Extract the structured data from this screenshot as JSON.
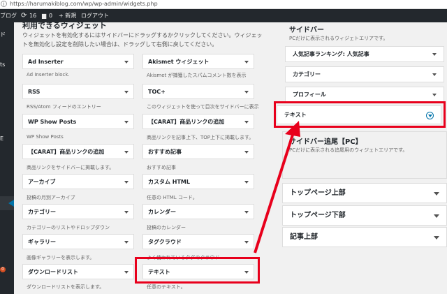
{
  "browser": {
    "url": "https://harumakiblog.com/wp/wp-admin/widgets.php",
    "info_icon": "info-icon"
  },
  "adminbar": {
    "site": "ブログ",
    "updates": "16",
    "comments": "0",
    "new": "+ 新規",
    "logout": "ログアウト"
  },
  "sidebar": {
    "items": [
      "ド",
      "ts",
      "E"
    ],
    "badge": "0"
  },
  "available": {
    "heading": "利用できるウィジェット",
    "desc": "ウィジェットを有効化するにはサイドバーにドラッグするかクリックしてください。ウィジェットを無効化し設定を削除したい場合は、ドラッグして右側に戻してください。",
    "widgets": [
      {
        "title": "Ad Inserter",
        "desc": "Ad Inserter block."
      },
      {
        "title": "Akismet ウィジェット",
        "desc": "Akismet が捕獲したスパムコメント数を表示"
      },
      {
        "title": "RSS",
        "desc": "RSS/Atom フィードのエントリー"
      },
      {
        "title": "TOC+",
        "desc": "このウィジェットを使って目次をサイドバーに表示"
      },
      {
        "title": "WP Show Posts",
        "desc": "WP Show Posts"
      },
      {
        "title": "【CARAT】商品リンクの追加",
        "desc": "商品リンクを記事上下、TOP上下に掲載します。"
      },
      {
        "title": "【CARAT】商品リンクの追加",
        "desc": "商品リンクをサイドバーに掲載します。"
      },
      {
        "title": "おすすめ記事",
        "desc": "おすすめ記事"
      },
      {
        "title": "アーカイブ",
        "desc": "投稿の月別アーカイブ"
      },
      {
        "title": "カスタム HTML",
        "desc": "任意の HTML コード。"
      },
      {
        "title": "カテゴリー",
        "desc": "カテゴリーのリストやドロップダウン"
      },
      {
        "title": "カレンダー",
        "desc": "投稿のカレンダー"
      },
      {
        "title": "ギャラリー",
        "desc": "画像ギャラリーを表示します。"
      },
      {
        "title": "タグクラウド",
        "desc": "よく使われているタグのクラウド"
      },
      {
        "title": "ダウンロードリスト",
        "desc": "ダウンロードリストを表示します。"
      },
      {
        "title": "テキスト",
        "desc": "任意のテキスト。"
      }
    ]
  },
  "areas": {
    "sidebar_title": "サイドバー",
    "sidebar_desc": "PCだけに表示されるウィジェトエリアです。",
    "sidebar_widgets": [
      "人気記事ランキング: 人気記事",
      "カテゴリー",
      "プロフィール",
      "テキスト"
    ],
    "follow_title": "サイドバー追尾【PC】",
    "follow_desc": "PCだけに表示される追尾用のウィジェトエリアです。",
    "collapsed": [
      "トップページ上部",
      "トップページ下部",
      "記事上部"
    ]
  },
  "colors": {
    "highlight": "#e8001c",
    "admin_bar": "#23282d",
    "accent": "#0073aa"
  }
}
